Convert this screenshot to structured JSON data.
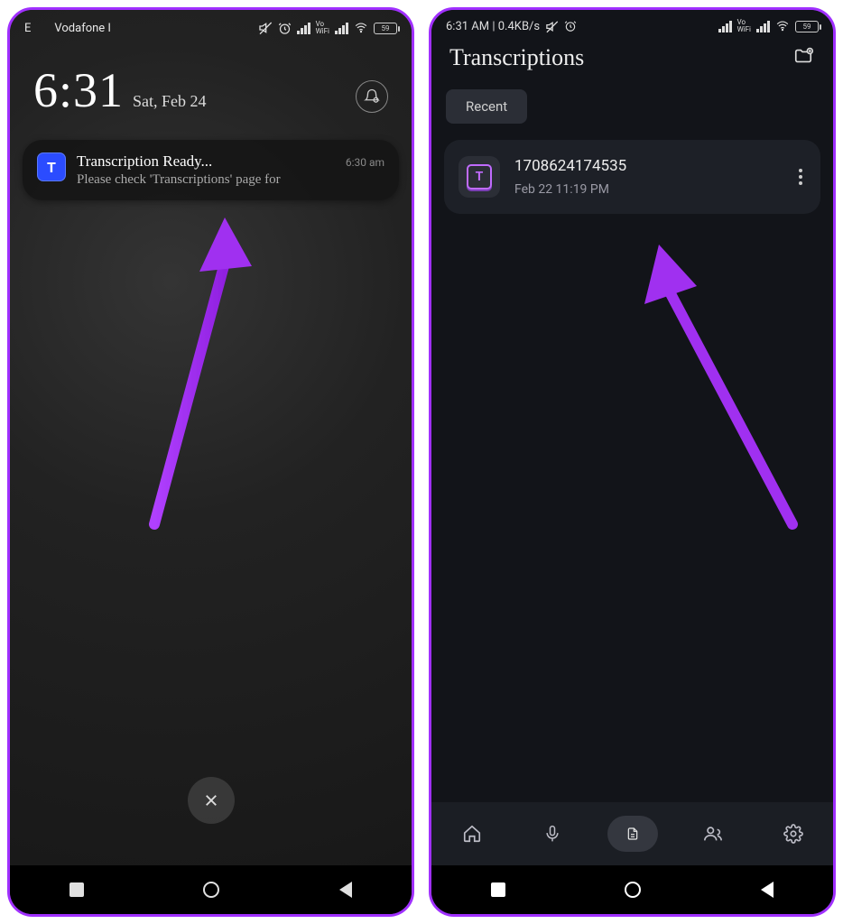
{
  "left": {
    "status": {
      "carrier_prefix": "E",
      "carrier": "Vodafone I",
      "battery": "59",
      "vo_label_line1": "Vo",
      "vo_label_line2": "WiFi"
    },
    "clock": "6:31",
    "date": "Sat, Feb 24",
    "notification": {
      "icon_letter": "T",
      "title": "Transcription Ready...",
      "time": "6:30 am",
      "desc": "Please check 'Transcriptions' page for"
    },
    "dismiss_label": "✕"
  },
  "right": {
    "status_left": "6:31 AM | 0.4KB/s",
    "status_battery": "59",
    "status_vo_l1": "Vo",
    "status_vo_l2": "WiFi",
    "title": "Transcriptions",
    "chip": "Recent",
    "item": {
      "icon_letter": "T",
      "name": "1708624174535",
      "date": "Feb 22 11:19 PM"
    }
  }
}
